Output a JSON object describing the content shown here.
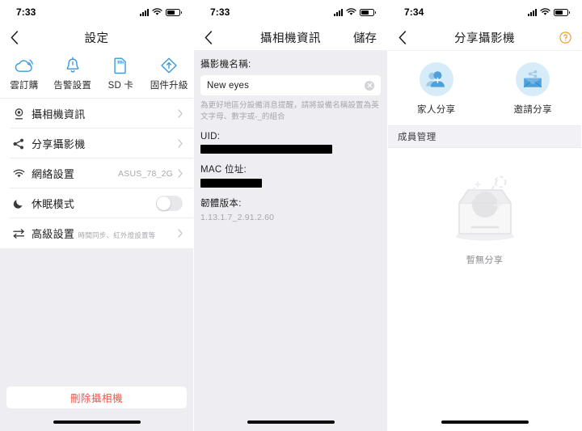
{
  "screens": [
    {
      "id": "settings",
      "status": {
        "time": "7:33",
        "signal_icon": "cellular-bars-icon",
        "wifi_icon": "wifi-icon",
        "battery_icon": "battery-icon"
      },
      "nav": {
        "back_icon": "chevron-left-icon",
        "title": "設定"
      },
      "quick_actions": [
        {
          "icon": "cloud-subscription-icon",
          "label": "雲訂購"
        },
        {
          "icon": "alarm-bell-icon",
          "label": "告警設置"
        },
        {
          "icon": "sd-card-icon",
          "label": "SD 卡"
        },
        {
          "icon": "firmware-upgrade-icon",
          "label": "固件升級"
        }
      ],
      "rows": [
        {
          "icon": "camera-info-icon",
          "label": "攝相機資訊",
          "sub": "",
          "value": "",
          "accessory": "chevron"
        },
        {
          "icon": "share-nodes-icon",
          "label": "分享攝影機",
          "sub": "",
          "value": "",
          "accessory": "chevron"
        },
        {
          "icon": "wifi-icon",
          "label": "網絡設置",
          "sub": "",
          "value": "ASUS_78_2G",
          "accessory": "chevron"
        },
        {
          "icon": "moon-sleep-icon",
          "label": "休眠模式",
          "sub": "",
          "value": "",
          "accessory": "toggle",
          "toggle_on": false
        },
        {
          "icon": "sliders-icon",
          "label": "高級設置",
          "sub": "時間同步、紅外燈設置等",
          "value": "",
          "accessory": "chevron"
        }
      ],
      "delete_button": {
        "label": "刪除攝相機",
        "color": "#f2554c"
      }
    },
    {
      "id": "camera-info",
      "status": {
        "time": "7:33",
        "signal_icon": "cellular-bars-icon",
        "wifi_icon": "wifi-icon",
        "battery_icon": "battery-icon"
      },
      "nav": {
        "back_icon": "chevron-left-icon",
        "title": "攝相機資訊",
        "right_label": "儲存"
      },
      "name_field": {
        "label": "攝影機名稱:",
        "value": "New eyes",
        "placeholder": "攝影機名稱",
        "clear_icon": "clear-circle-icon"
      },
      "hint": "為更好地區分設備消息提醒，請將設備名稱設置為英文字母、數字或-_的組合",
      "uid": {
        "label": "UID:",
        "value": "",
        "redacted": true
      },
      "mac": {
        "label": "MAC 位址:",
        "value": "",
        "redacted": true
      },
      "firmware": {
        "label": "韌體版本:",
        "value": "1.13.1.7_2.91.2.60"
      }
    },
    {
      "id": "share-camera",
      "status": {
        "time": "7:34",
        "signal_icon": "cellular-bars-icon",
        "wifi_icon": "wifi-icon",
        "battery_icon": "battery-icon"
      },
      "nav": {
        "back_icon": "chevron-left-icon",
        "title": "分享攝影機",
        "help_icon": "help-circle-icon"
      },
      "share_options": [
        {
          "icon": "family-share-icon",
          "label": "家人分享"
        },
        {
          "icon": "invite-envelope-icon",
          "label": "邀請分享"
        }
      ],
      "section": {
        "title": "成員管理"
      },
      "empty_state": {
        "illustration": "empty-tray-icon",
        "text": "暫無分享"
      }
    }
  ],
  "theme": {
    "accent_blue": "#2f8fd8",
    "icon_blue": "#3a9ada",
    "danger_red": "#f2554c",
    "help_orange": "#f0a030",
    "page_bg": "#eeeef2",
    "card_bg": "#ffffff"
  }
}
